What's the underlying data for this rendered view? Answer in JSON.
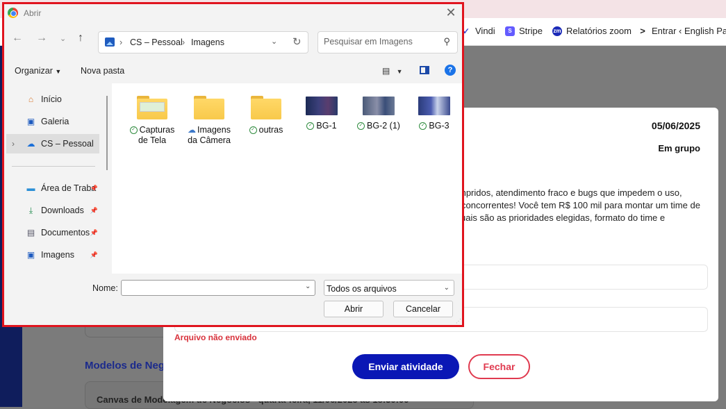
{
  "browser": {
    "bookmarks": [
      {
        "label": "Vindi",
        "icon": "vindi-icon",
        "color": "#3d4bd1"
      },
      {
        "label": "Stripe",
        "icon": "stripe-icon",
        "color": "#635bff"
      },
      {
        "label": "Relatórios zoom",
        "icon": "zoom-icon",
        "color": "#1b2ab8"
      },
      {
        "label": "Entrar ‹ English Pass",
        "icon": "english-pass-icon",
        "color": "#222222"
      }
    ]
  },
  "page": {
    "section_title": "Modelos de Neg",
    "card_text": "Canvas de Modelagem de Negócios - quarta-feira, 11/06/2025 às 18:30:00"
  },
  "modal": {
    "date": "05/06/2025",
    "mode": "Em grupo",
    "desc_lines": [
      "mpridos, atendimento fraco e bugs que impedem o uso,",
      "concorrentes! Você tem R$ 100 mil para montar um time de",
      "uais são as prioridades elegidas, formato do time e"
    ],
    "error": "Arquivo não enviado",
    "send_label": "Enviar atividade",
    "close_label": "Fechar",
    "colors": {
      "primary": "#0a17b5",
      "danger": "#e03a4f"
    }
  },
  "dialog": {
    "title": "Abrir",
    "path": [
      "CS – Pessoal",
      "Imagens"
    ],
    "search_placeholder": "Pesquisar em Imagens",
    "organize_label": "Organizar",
    "new_folder_label": "Nova pasta",
    "sidebar": [
      {
        "label": "Início",
        "icon": "home-icon"
      },
      {
        "label": "Galeria",
        "icon": "gallery-icon"
      },
      {
        "label": "CS – Pessoal",
        "icon": "onedrive-cloud-icon",
        "selected": true
      },
      {
        "label": "Área de Traba",
        "icon": "desktop-icon",
        "pinned": true
      },
      {
        "label": "Downloads",
        "icon": "download-icon",
        "pinned": true
      },
      {
        "label": "Documentos",
        "icon": "documents-icon",
        "pinned": true
      },
      {
        "label": "Imagens",
        "icon": "pictures-icon",
        "pinned": true
      }
    ],
    "files": [
      {
        "name": "Capturas de Tela",
        "kind": "folder-screenshot",
        "status": "synced"
      },
      {
        "name": "Imagens da Câmera",
        "kind": "folder",
        "status": "cloud"
      },
      {
        "name": "outras",
        "kind": "folder",
        "status": "synced"
      },
      {
        "name": "BG-1",
        "kind": "image",
        "status": "synced"
      },
      {
        "name": "BG-2 (1)",
        "kind": "image",
        "status": "synced"
      },
      {
        "name": "BG-3",
        "kind": "image",
        "status": "synced"
      }
    ],
    "name_label": "Nome:",
    "name_value": "",
    "filetype": "Todos os arquivos",
    "open_label": "Abrir",
    "cancel_label": "Cancelar",
    "highlight_color": "#e0141e"
  }
}
